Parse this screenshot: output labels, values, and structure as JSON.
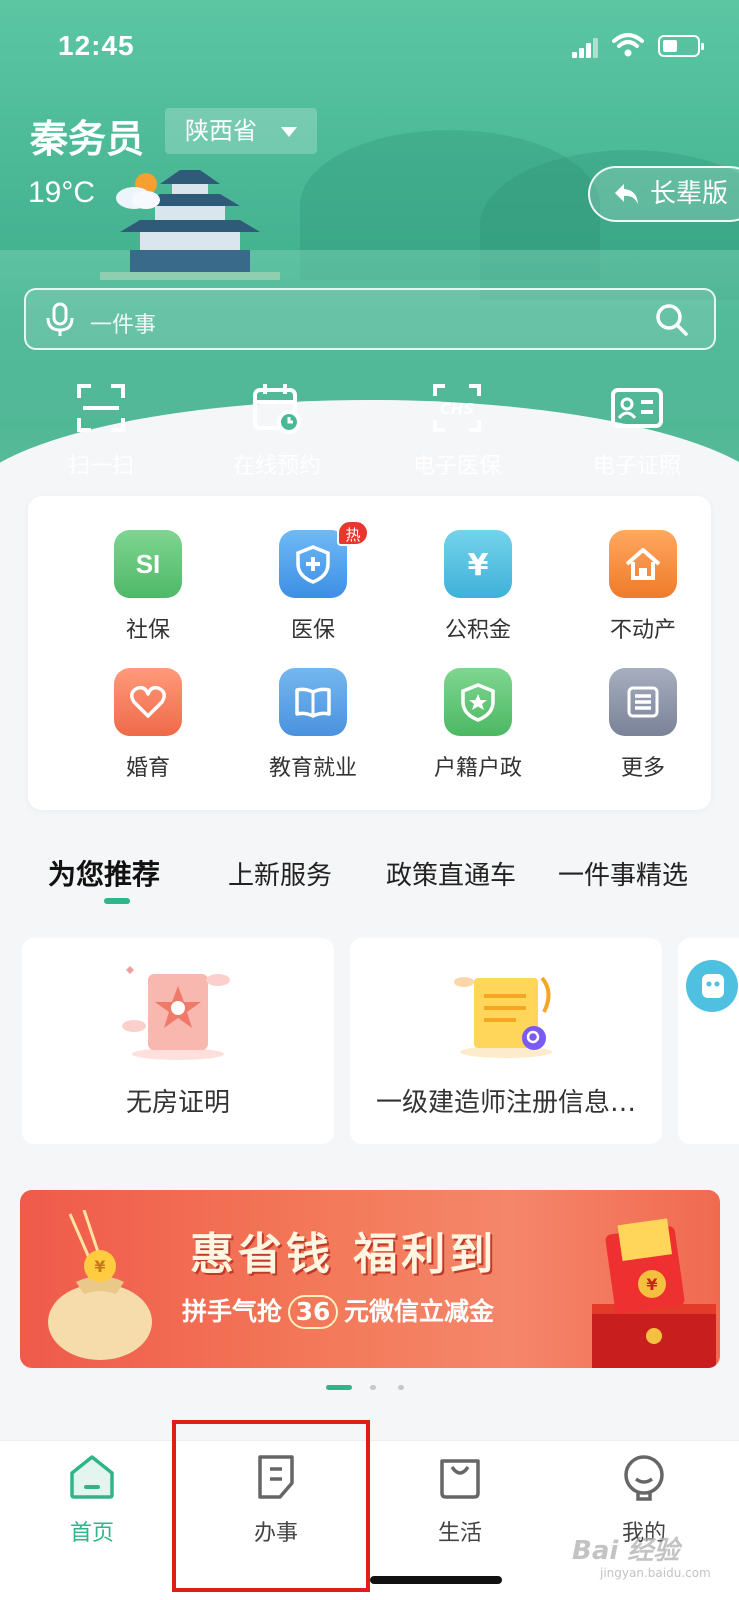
{
  "status": {
    "time": "12:45"
  },
  "header": {
    "app_name": "秦务员",
    "province": "陕西省",
    "temperature": "19°C",
    "elder_mode": "长辈版"
  },
  "search": {
    "placeholder": "一件事"
  },
  "quick_actions": [
    {
      "label": "扫一扫",
      "icon": "scan-icon"
    },
    {
      "label": "在线预约",
      "icon": "calendar-clock-icon"
    },
    {
      "label": "电子医保",
      "icon": "chs-card-icon"
    },
    {
      "label": "电子证照",
      "icon": "id-card-icon"
    }
  ],
  "services": [
    {
      "label": "社保",
      "icon": "si-icon",
      "glyph": "SI",
      "color": "#5fc07a"
    },
    {
      "label": "医保",
      "icon": "shield-cross-icon",
      "color": "#4da3ee",
      "badge": "热"
    },
    {
      "label": "公积金",
      "icon": "yen-icon",
      "glyph": "¥",
      "color": "#4fc0e0"
    },
    {
      "label": "不动产",
      "icon": "house-icon",
      "color": "#f5883a"
    },
    {
      "label": "婚育",
      "icon": "heart-icon",
      "color": "#f08060"
    },
    {
      "label": "教育就业",
      "icon": "book-icon",
      "color": "#5aa7ea"
    },
    {
      "label": "户籍户政",
      "icon": "police-badge-icon",
      "color": "#5ec275"
    },
    {
      "label": "更多",
      "icon": "more-icon",
      "color": "#8a93a8"
    }
  ],
  "tabs": [
    "为您推荐",
    "上新服务",
    "政策直通车",
    "一件事精选"
  ],
  "cards": [
    {
      "label": "无房证明"
    },
    {
      "label": "一级建造师注册信息…"
    }
  ],
  "banner": {
    "title": "惠省钱 福利到",
    "sub_before": "拼手气抢",
    "amount": "36",
    "sub_after": "元微信立减金"
  },
  "nav": [
    {
      "label": "首页",
      "icon": "home-icon"
    },
    {
      "label": "办事",
      "icon": "document-icon"
    },
    {
      "label": "生活",
      "icon": "shopping-bag-icon"
    },
    {
      "label": "我的",
      "icon": "user-face-icon"
    }
  ],
  "watermark": {
    "brand": "Bai 经验",
    "url": "jingyan.baidu.com"
  },
  "colors": {
    "accent": "#2eb589",
    "highlight": "#e21b1b"
  }
}
